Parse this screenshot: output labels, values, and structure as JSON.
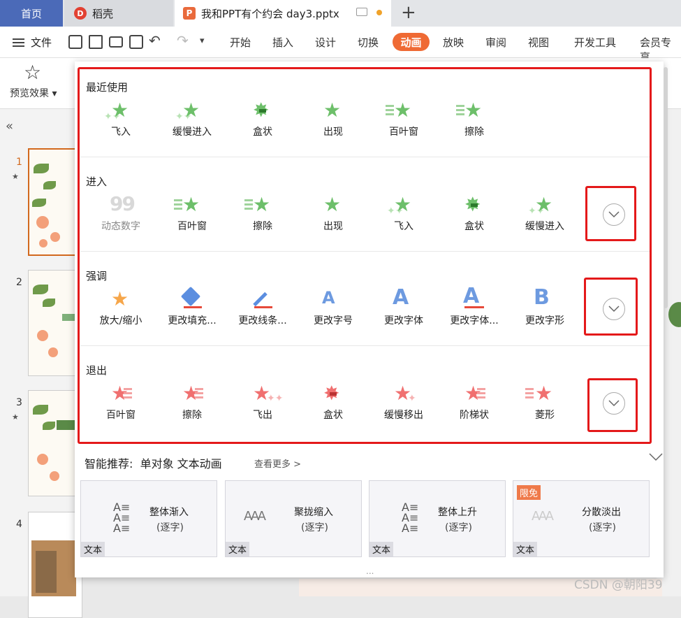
{
  "tabs": {
    "home": "首页",
    "daoke": "稻壳",
    "document": "我和PPT有个约会 day3.pptx",
    "new_tab": "+"
  },
  "menubar": {
    "file": "文件",
    "items": [
      "开始",
      "插入",
      "设计",
      "切换",
      "动画",
      "放映",
      "审阅",
      "视图",
      "开发工具",
      "会员专享"
    ],
    "active": "动画"
  },
  "ribbon": {
    "preview": "预览效果"
  },
  "sidebar": {
    "slide_numbers": [
      "1",
      "2",
      "3",
      "4"
    ],
    "collapse_icon": "double-chevron-left-icon"
  },
  "panel": {
    "sections": {
      "recent": {
        "title": "最近使用",
        "items": [
          "飞入",
          "缓慢进入",
          "盒状",
          "出现",
          "百叶窗",
          "擦除"
        ]
      },
      "enter": {
        "title": "进入",
        "items": [
          "动态数字",
          "百叶窗",
          "擦除",
          "出现",
          "飞入",
          "盒状",
          "缓慢进入"
        ]
      },
      "emphasis": {
        "title": "强调",
        "items": [
          "放大/缩小",
          "更改填充...",
          "更改线条...",
          "更改字号",
          "更改字体",
          "更改字体...",
          "更改字形"
        ]
      },
      "exit": {
        "title": "退出",
        "items": [
          "百叶窗",
          "擦除",
          "飞出",
          "盒状",
          "缓慢移出",
          "阶梯状",
          "菱形"
        ]
      }
    },
    "recommend": {
      "title": "智能推荐:",
      "subtitle": "单对象 文本动画",
      "more": "查看更多 >",
      "cards": [
        {
          "name": "整体渐入",
          "sub": "(逐字)",
          "tag": "文本"
        },
        {
          "name": "聚拢缩入",
          "sub": "(逐字)",
          "tag": "文本"
        },
        {
          "name": "整体上升",
          "sub": "(逐字)",
          "tag": "文本"
        },
        {
          "name": "分散淡出",
          "sub": "(逐字)",
          "tag": "文本",
          "badge": "限免"
        }
      ]
    },
    "grip": "..."
  },
  "watermark": "CSDN @朝阳39",
  "colors": {
    "accent": "#ef6a34",
    "home_tab": "#4b6ab8",
    "highlight_box": "#e4191a",
    "enter_star": "#6dbf6a",
    "exit_star": "#f07070"
  }
}
